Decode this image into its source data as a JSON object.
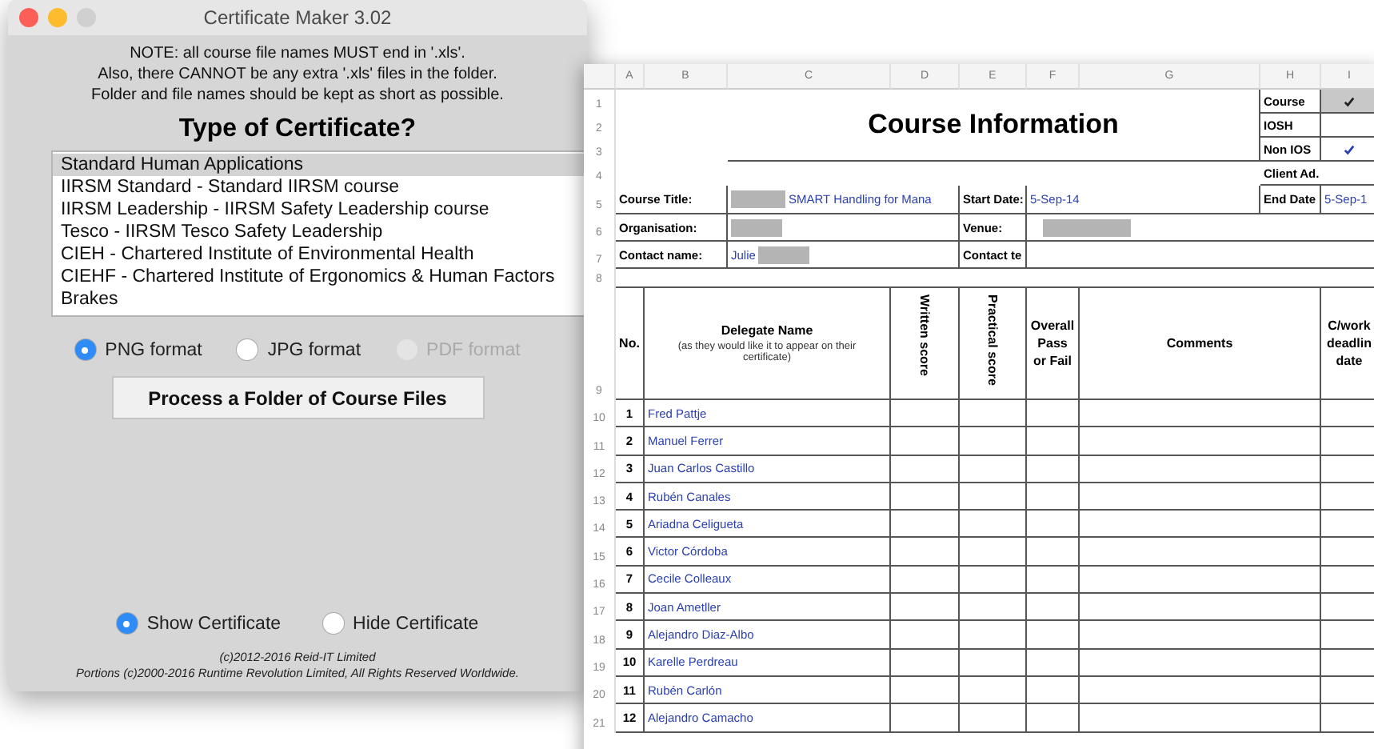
{
  "app_window": {
    "title": "Certificate Maker 3.02",
    "notes": [
      "NOTE: all course file names MUST end in '.xls'.",
      "Also, there CANNOT be any extra '.xls' files in the folder.",
      "Folder and file names should be kept as short as possible."
    ],
    "heading": "Type of Certificate?",
    "certificate_types": [
      {
        "label": "Standard Human Applications",
        "selected": true
      },
      {
        "label": "IIRSM Standard - Standard IIRSM course",
        "selected": false
      },
      {
        "label": "IIRSM Leadership - IIRSM Safety Leadership course",
        "selected": false
      },
      {
        "label": "Tesco - IIRSM Tesco Safety Leadership",
        "selected": false
      },
      {
        "label": "CIEH - Chartered Institute of Environmental Health",
        "selected": false
      },
      {
        "label": "CIEHF - Chartered Institute of Ergonomics & Human Factors",
        "selected": false
      },
      {
        "label": "Brakes",
        "selected": false
      }
    ],
    "formats": [
      {
        "label": "PNG format",
        "selected": true,
        "disabled": false
      },
      {
        "label": "JPG format",
        "selected": false,
        "disabled": false
      },
      {
        "label": "PDF format",
        "selected": false,
        "disabled": true
      }
    ],
    "process_button": "Process a Folder of Course Files",
    "display_options": [
      {
        "label": "Show Certificate",
        "selected": true
      },
      {
        "label": "Hide Certificate",
        "selected": false
      }
    ],
    "footer": [
      "(c)2012-2016 Reid-IT Limited",
      "Portions (c)2000-2016 Runtime Revolution Limited, All Rights Reserved Worldwide."
    ]
  },
  "spreadsheet": {
    "columns": [
      "A",
      "B",
      "C",
      "D",
      "E",
      "F",
      "G",
      "H",
      "I"
    ],
    "row_numbers": [
      "1",
      "2",
      "3",
      "4",
      "5",
      "6",
      "7",
      "8",
      "9",
      "10",
      "11",
      "12",
      "13",
      "14",
      "15",
      "16",
      "17",
      "18",
      "19",
      "20",
      "21"
    ],
    "title": "Course Information",
    "flags": [
      {
        "label": "Course",
        "checked": true
      },
      {
        "label": "IOSH",
        "checked": false
      },
      {
        "label": "Non IOS",
        "checked": true
      }
    ],
    "client_label": "Client Ad.",
    "course_title": {
      "label": "Course Title:",
      "value": "SMART Handling for Mana",
      "redacted": true
    },
    "start_date": {
      "label": "Start Date:",
      "value": "5-Sep-14"
    },
    "end_date": {
      "label": "End Date",
      "value": "5-Sep-1"
    },
    "organisation": {
      "label": "Organisation:",
      "redacted": true
    },
    "venue": {
      "label": "Venue:",
      "redacted": true
    },
    "contact_name": {
      "label": "Contact name:",
      "value": "Julie",
      "redacted": true
    },
    "contact_tel": {
      "label": "Contact te"
    },
    "headers": {
      "no": "No.",
      "delegate": "Delegate Name",
      "delegate_note": "(as they would like it to appear on their certificate)",
      "written": "Written score",
      "practical": "Practical score",
      "overall": "Overall Pass or Fail",
      "comments": "Comments",
      "coursework": "C/work deadlin date"
    },
    "delegates": [
      {
        "no": "1",
        "name": "Fred Pattje"
      },
      {
        "no": "2",
        "name": "Manuel Ferrer"
      },
      {
        "no": "3",
        "name": "Juan Carlos Castillo"
      },
      {
        "no": "4",
        "name": "Rubén Canales"
      },
      {
        "no": "5",
        "name": "Ariadna Celigueta"
      },
      {
        "no": "6",
        "name": "Victor Córdoba"
      },
      {
        "no": "7",
        "name": "Cecile Colleaux"
      },
      {
        "no": "8",
        "name": "Joan Ametller"
      },
      {
        "no": "9",
        "name": "Alejandro Diaz-Albo"
      },
      {
        "no": "10",
        "name": "Karelle Perdreau"
      },
      {
        "no": "11",
        "name": "Rubén Carlón"
      },
      {
        "no": "12",
        "name": "Alejandro Camacho"
      }
    ]
  }
}
